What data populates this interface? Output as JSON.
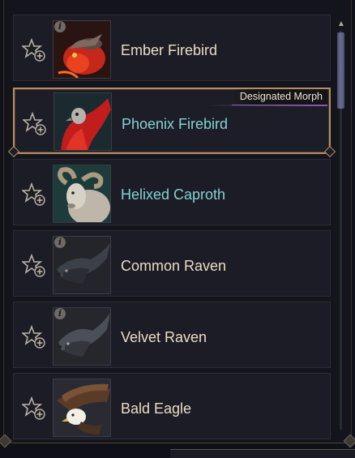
{
  "panel": {
    "selected_tag": "Designated Morph",
    "items": [
      {
        "name": "Ember Firebird",
        "name_color": "cream",
        "info": true,
        "selected": false,
        "portrait": "ember-firebird"
      },
      {
        "name": "Phoenix Firebird",
        "name_color": "cyan",
        "info": false,
        "selected": true,
        "portrait": "phoenix-firebird"
      },
      {
        "name": "Helixed Caproth",
        "name_color": "cyan",
        "info": false,
        "selected": false,
        "portrait": "helixed-caproth"
      },
      {
        "name": "Common Raven",
        "name_color": "cream",
        "info": true,
        "selected": false,
        "portrait": "common-raven"
      },
      {
        "name": "Velvet Raven",
        "name_color": "cream",
        "info": true,
        "selected": false,
        "portrait": "velvet-raven"
      },
      {
        "name": "Bald Eagle",
        "name_color": "cream",
        "info": false,
        "selected": false,
        "portrait": "bald-eagle"
      }
    ]
  },
  "icons": {
    "favorite": "star-add-icon",
    "info": "info-icon",
    "scroll_up": "chevron-up-icon"
  },
  "glyphs": {
    "info": "i",
    "scroll_up": "▲"
  },
  "colors": {
    "name_cream": "#ecdcc3",
    "name_cyan": "#84d1d4",
    "selected_border": "#b58d62",
    "tag_accent": "#8f55b5"
  }
}
